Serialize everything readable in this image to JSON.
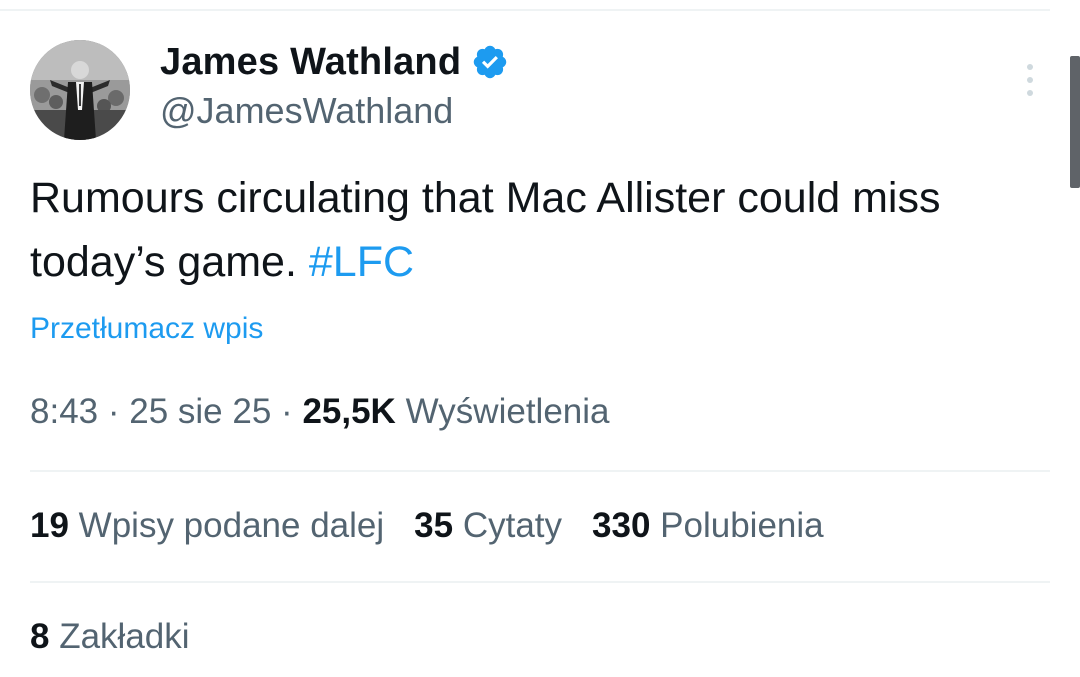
{
  "author": {
    "display_name": "James Wathland",
    "handle": "@JamesWathland",
    "verified": true,
    "avatar_icon": "profile-photo-icon"
  },
  "tweet": {
    "text": "Rumours circulating that Mac Allister could miss today’s game.",
    "hashtag": "#LFC",
    "translate_label": "Przetłumacz wpis"
  },
  "meta": {
    "time": "8:43",
    "separator": "·",
    "date": "25 sie 25",
    "views_count": "25,5K",
    "views_label": "Wyświetlenia"
  },
  "stats": {
    "reposts_count": "19",
    "reposts_label": "Wpisy podane dalej",
    "quotes_count": "35",
    "quotes_label": "Cytaty",
    "likes_count": "330",
    "likes_label": "Polubienia",
    "bookmarks_count": "8",
    "bookmarks_label": "Zakładki"
  },
  "icons": {
    "verified": "verified-badge-icon",
    "more": "more-vertical-icon"
  },
  "colors": {
    "accent": "#1d9bf0",
    "text_primary": "#0f1419",
    "text_secondary": "#536471",
    "divider": "#eff3f4"
  }
}
